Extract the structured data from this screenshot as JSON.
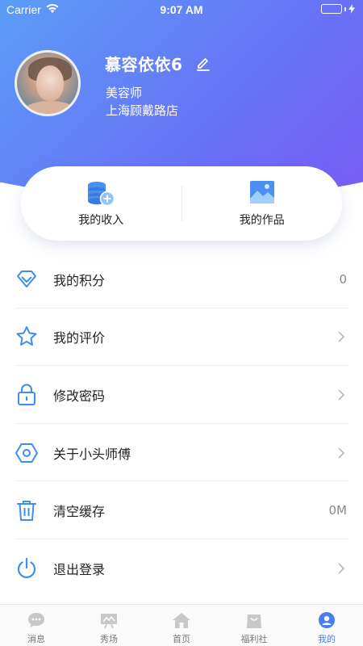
{
  "status_bar": {
    "carrier": "Carrier",
    "time": "9:07 AM",
    "battery_level": 1.0
  },
  "profile": {
    "name": "慕容依依6",
    "role": "美容师",
    "store": "上海顾戴路店"
  },
  "quick_actions": [
    {
      "label": "我的收入",
      "icon": "income-coins-icon"
    },
    {
      "label": "我的作品",
      "icon": "works-image-icon"
    }
  ],
  "menu": [
    {
      "label": "我的积分",
      "icon": "diamond-icon",
      "value": "0"
    },
    {
      "label": "我的评价",
      "icon": "star-icon"
    },
    {
      "label": "修改密码",
      "icon": "lock-icon"
    },
    {
      "label": "关于小头师傅",
      "icon": "hexagon-icon"
    },
    {
      "label": "清空缓存",
      "icon": "trash-icon",
      "value": "0M"
    },
    {
      "label": "退出登录",
      "icon": "power-icon"
    }
  ],
  "tabs": [
    {
      "label": "消息",
      "icon": "message-bubble-icon"
    },
    {
      "label": "秀场",
      "icon": "showcase-board-icon"
    },
    {
      "label": "首页",
      "icon": "home-icon"
    },
    {
      "label": "福利社",
      "icon": "shopping-bag-icon"
    },
    {
      "label": "我的",
      "icon": "user-profile-icon",
      "active": true
    }
  ],
  "colors": {
    "header_gradient_start": "#5b9cf7",
    "header_gradient_end": "#7a5cf5",
    "accent_blue": "#3d8ef0",
    "active_tab": "#4a7df0",
    "battery": "#4cd964"
  }
}
